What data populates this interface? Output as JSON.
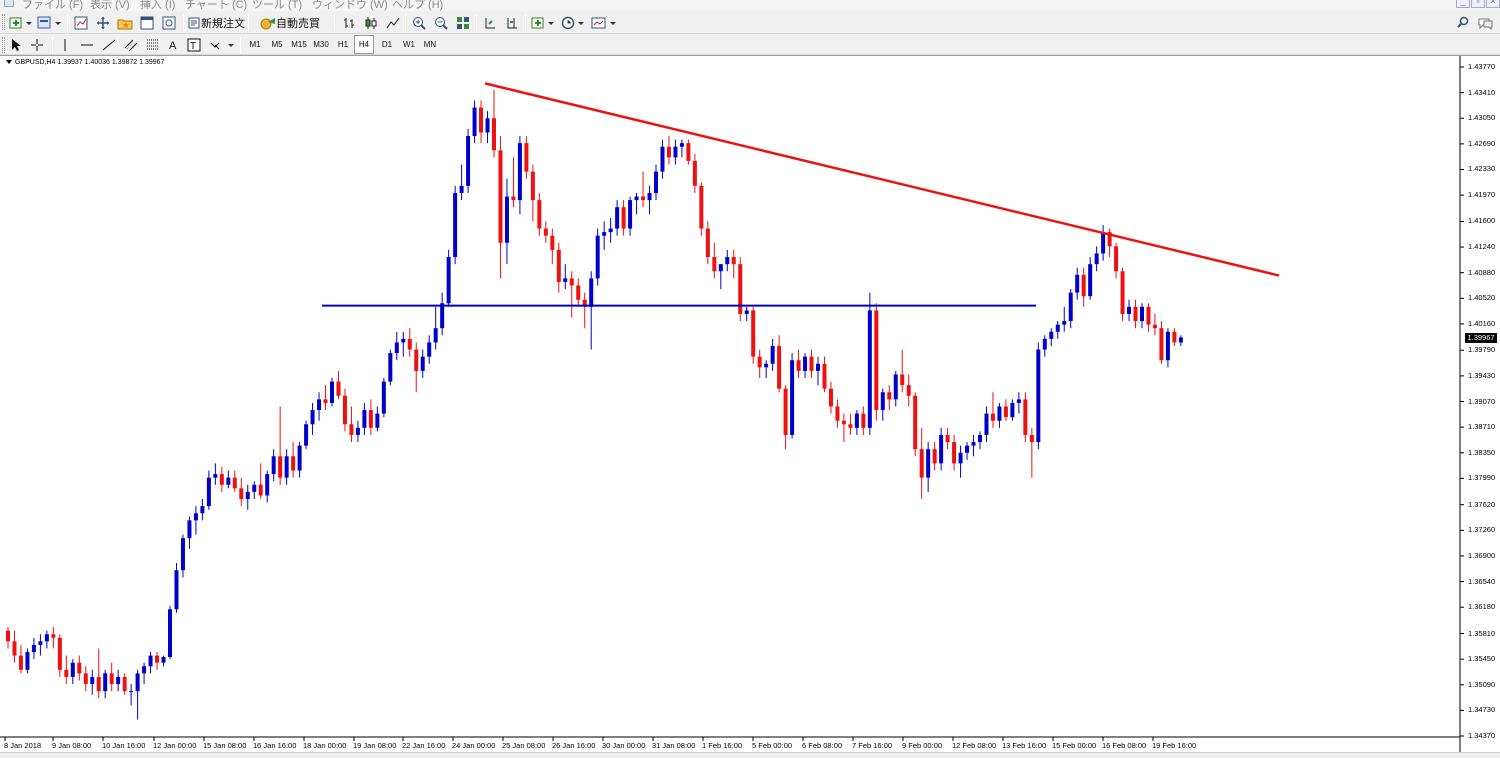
{
  "menu": {
    "items": [
      "ファイル (F)",
      "表示 (V)",
      "挿入 (I)",
      "チャート (C)",
      "ツール (T)",
      "ウィンドウ (W)",
      "ヘルプ (H)"
    ]
  },
  "toolbar": {
    "new_order_label": "新規注文",
    "auto_trade_label": "自動売買",
    "timeframes": [
      "M1",
      "M5",
      "M15",
      "M30",
      "H1",
      "H4",
      "D1",
      "W1",
      "MN"
    ],
    "active_timeframe": "H4"
  },
  "chart": {
    "header": "GBPUSD,H4  1.39937 1.40036 1.39872 1.39967",
    "current_price": "1.39967",
    "price_ticks": [
      "1.43770",
      "1.43410",
      "1.43050",
      "1.42690",
      "1.42330",
      "1.41970",
      "1.41600",
      "1.41240",
      "1.40880",
      "1.40520",
      "1.40160",
      "1.39790",
      "1.39430",
      "1.39070",
      "1.38710",
      "1.38350",
      "1.37990",
      "1.37620",
      "1.37260",
      "1.36900",
      "1.36540",
      "1.36180",
      "1.35810",
      "1.35450",
      "1.35090",
      "1.34730",
      "1.34370"
    ],
    "time_ticks": [
      "8 Jan 2018",
      "9 Jan 08:00",
      "10 Jan 16:00",
      "12 Jan 00:00",
      "15 Jan 08:00",
      "16 Jan 16:00",
      "18 Jan 00:00",
      "19 Jan 08:00",
      "22 Jan 16:00",
      "24 Jan 00:00",
      "25 Jan 08:00",
      "26 Jan 16:00",
      "30 Jan 00:00",
      "31 Jan 08:00",
      "1 Feb 16:00",
      "5 Feb 00:00",
      "6 Feb 08:00",
      "7 Feb 16:00",
      "9 Feb 00:00",
      "12 Feb 08:00",
      "13 Feb 16:00",
      "15 Feb 00:00",
      "16 Feb 08:00",
      "19 Feb 16:00"
    ],
    "colors": {
      "bull": "#0000cc",
      "bear": "#ee1111",
      "trendline": "#ee1111",
      "support": "#0000cc"
    }
  },
  "chart_data": {
    "type": "candlestick",
    "symbol": "GBPUSD",
    "timeframe": "H4",
    "ylim": [
      1.3437,
      1.4377
    ],
    "candles": [
      [
        1.3585,
        1.359,
        1.356,
        1.357
      ],
      [
        1.357,
        1.3585,
        1.354,
        1.355
      ],
      [
        1.355,
        1.3565,
        1.3525,
        1.353
      ],
      [
        1.353,
        1.356,
        1.3525,
        1.3555
      ],
      [
        1.3555,
        1.3575,
        1.3545,
        1.3565
      ],
      [
        1.3565,
        1.358,
        1.355,
        1.357
      ],
      [
        1.357,
        1.3585,
        1.356,
        1.358
      ],
      [
        1.358,
        1.359,
        1.356,
        1.3575
      ],
      [
        1.3575,
        1.358,
        1.352,
        1.353
      ],
      [
        1.353,
        1.355,
        1.351,
        1.352
      ],
      [
        1.352,
        1.3545,
        1.351,
        1.354
      ],
      [
        1.354,
        1.355,
        1.3515,
        1.3525
      ],
      [
        1.3525,
        1.3535,
        1.35,
        1.351
      ],
      [
        1.351,
        1.353,
        1.3495,
        1.352
      ],
      [
        1.352,
        1.356,
        1.349,
        1.35
      ],
      [
        1.35,
        1.353,
        1.349,
        1.3525
      ],
      [
        1.3525,
        1.354,
        1.35,
        1.351
      ],
      [
        1.351,
        1.353,
        1.35,
        1.352
      ],
      [
        1.352,
        1.3525,
        1.3495,
        1.35
      ],
      [
        1.35,
        1.351,
        1.348,
        1.35
      ],
      [
        1.35,
        1.353,
        1.346,
        1.3525
      ],
      [
        1.3525,
        1.354,
        1.351,
        1.3535
      ],
      [
        1.3535,
        1.3555,
        1.3525,
        1.355
      ],
      [
        1.355,
        1.3555,
        1.353,
        1.354
      ],
      [
        1.354,
        1.355,
        1.3535,
        1.3548
      ],
      [
        1.3548,
        1.362,
        1.3545,
        1.3615
      ],
      [
        1.3615,
        1.368,
        1.361,
        1.367
      ],
      [
        1.367,
        1.372,
        1.366,
        1.3715
      ],
      [
        1.3715,
        1.3745,
        1.37,
        1.374
      ],
      [
        1.374,
        1.376,
        1.372,
        1.375
      ],
      [
        1.375,
        1.377,
        1.374,
        1.376
      ],
      [
        1.376,
        1.381,
        1.3755,
        1.38
      ],
      [
        1.38,
        1.382,
        1.379,
        1.3805
      ],
      [
        1.3805,
        1.3815,
        1.378,
        1.379
      ],
      [
        1.379,
        1.381,
        1.3785,
        1.38
      ],
      [
        1.38,
        1.381,
        1.378,
        1.3785
      ],
      [
        1.3785,
        1.38,
        1.376,
        1.377
      ],
      [
        1.377,
        1.379,
        1.3755,
        1.378
      ],
      [
        1.378,
        1.3795,
        1.377,
        1.379
      ],
      [
        1.379,
        1.382,
        1.377,
        1.3775
      ],
      [
        1.3775,
        1.381,
        1.3765,
        1.3805
      ],
      [
        1.3805,
        1.384,
        1.3795,
        1.383
      ],
      [
        1.383,
        1.39,
        1.379,
        1.38
      ],
      [
        1.38,
        1.384,
        1.379,
        1.383
      ],
      [
        1.383,
        1.385,
        1.38,
        1.381
      ],
      [
        1.381,
        1.385,
        1.38,
        1.3845
      ],
      [
        1.3845,
        1.388,
        1.384,
        1.3875
      ],
      [
        1.3875,
        1.3905,
        1.386,
        1.3895
      ],
      [
        1.3895,
        1.392,
        1.388,
        1.391
      ],
      [
        1.391,
        1.393,
        1.3895,
        1.3905
      ],
      [
        1.3905,
        1.394,
        1.39,
        1.3935
      ],
      [
        1.3935,
        1.395,
        1.391,
        1.3915
      ],
      [
        1.3915,
        1.3925,
        1.3865,
        1.3875
      ],
      [
        1.3875,
        1.39,
        1.385,
        1.386
      ],
      [
        1.386,
        1.388,
        1.385,
        1.387
      ],
      [
        1.387,
        1.3905,
        1.386,
        1.3895
      ],
      [
        1.3895,
        1.391,
        1.386,
        1.387
      ],
      [
        1.387,
        1.39,
        1.3865,
        1.389
      ],
      [
        1.389,
        1.394,
        1.3885,
        1.3935
      ],
      [
        1.3935,
        1.398,
        1.393,
        1.3975
      ],
      [
        1.3975,
        1.4005,
        1.3965,
        1.399
      ],
      [
        1.399,
        1.4005,
        1.397,
        1.3995
      ],
      [
        1.3995,
        1.401,
        1.397,
        1.398
      ],
      [
        1.398,
        1.399,
        1.392,
        1.395
      ],
      [
        1.395,
        1.398,
        1.394,
        1.397
      ],
      [
        1.397,
        1.4,
        1.396,
        1.399
      ],
      [
        1.399,
        1.404,
        1.398,
        1.401
      ],
      [
        1.401,
        1.406,
        1.4,
        1.4045
      ],
      [
        1.4045,
        1.412,
        1.404,
        1.411
      ],
      [
        1.411,
        1.421,
        1.41,
        1.42
      ],
      [
        1.42,
        1.424,
        1.419,
        1.421
      ],
      [
        1.421,
        1.429,
        1.42,
        1.428
      ],
      [
        1.428,
        1.433,
        1.427,
        1.432
      ],
      [
        1.432,
        1.433,
        1.427,
        1.4285
      ],
      [
        1.4285,
        1.4315,
        1.427,
        1.4305
      ],
      [
        1.4305,
        1.4345,
        1.425,
        1.426
      ],
      [
        1.426,
        1.428,
        1.408,
        1.413
      ],
      [
        1.413,
        1.422,
        1.41,
        1.4195
      ],
      [
        1.4195,
        1.425,
        1.418,
        1.419
      ],
      [
        1.419,
        1.428,
        1.417,
        1.427
      ],
      [
        1.427,
        1.428,
        1.422,
        1.423
      ],
      [
        1.423,
        1.424,
        1.416,
        1.419
      ],
      [
        1.419,
        1.42,
        1.414,
        1.415
      ],
      [
        1.415,
        1.416,
        1.413,
        1.414
      ],
      [
        1.414,
        1.415,
        1.41,
        1.412
      ],
      [
        1.412,
        1.413,
        1.406,
        1.4075
      ],
      [
        1.4075,
        1.41,
        1.4065,
        1.408
      ],
      [
        1.408,
        1.409,
        1.4025,
        1.407
      ],
      [
        1.407,
        1.408,
        1.404,
        1.405
      ],
      [
        1.405,
        1.406,
        1.401,
        1.404
      ],
      [
        1.404,
        1.409,
        1.398,
        1.408
      ],
      [
        1.408,
        1.415,
        1.407,
        1.414
      ],
      [
        1.414,
        1.416,
        1.412,
        1.4145
      ],
      [
        1.4145,
        1.4165,
        1.413,
        1.415
      ],
      [
        1.415,
        1.419,
        1.414,
        1.418
      ],
      [
        1.418,
        1.419,
        1.414,
        1.415
      ],
      [
        1.415,
        1.4195,
        1.414,
        1.419
      ],
      [
        1.419,
        1.42,
        1.417,
        1.4195
      ],
      [
        1.4195,
        1.423,
        1.418,
        1.419
      ],
      [
        1.419,
        1.421,
        1.417,
        1.42
      ],
      [
        1.42,
        1.424,
        1.419,
        1.423
      ],
      [
        1.423,
        1.4275,
        1.422,
        1.4265
      ],
      [
        1.4265,
        1.428,
        1.424,
        1.425
      ],
      [
        1.425,
        1.4275,
        1.424,
        1.4265
      ],
      [
        1.4265,
        1.4275,
        1.425,
        1.427
      ],
      [
        1.427,
        1.4275,
        1.424,
        1.4245
      ],
      [
        1.4245,
        1.4255,
        1.42,
        1.421
      ],
      [
        1.421,
        1.4215,
        1.414,
        1.415
      ],
      [
        1.415,
        1.416,
        1.41,
        1.411
      ],
      [
        1.411,
        1.413,
        1.408,
        1.409
      ],
      [
        1.409,
        1.41,
        1.4065,
        1.41
      ],
      [
        1.41,
        1.412,
        1.409,
        1.411
      ],
      [
        1.411,
        1.412,
        1.408,
        1.41
      ],
      [
        1.41,
        1.411,
        1.402,
        1.403
      ],
      [
        1.403,
        1.404,
        1.402,
        1.4035
      ],
      [
        1.4035,
        1.404,
        1.396,
        1.397
      ],
      [
        1.397,
        1.398,
        1.394,
        1.3955
      ],
      [
        1.3955,
        1.3965,
        1.394,
        1.396
      ],
      [
        1.396,
        1.3995,
        1.395,
        1.3985
      ],
      [
        1.3985,
        1.4,
        1.392,
        1.3925
      ],
      [
        1.3925,
        1.393,
        1.384,
        1.386
      ],
      [
        1.386,
        1.3975,
        1.3855,
        1.3965
      ],
      [
        1.3965,
        1.398,
        1.394,
        1.395
      ],
      [
        1.395,
        1.3975,
        1.394,
        1.397
      ],
      [
        1.397,
        1.398,
        1.394,
        1.395
      ],
      [
        1.395,
        1.397,
        1.393,
        1.396
      ],
      [
        1.396,
        1.397,
        1.392,
        1.3925
      ],
      [
        1.3925,
        1.3935,
        1.389,
        1.39
      ],
      [
        1.39,
        1.391,
        1.387,
        1.388
      ],
      [
        1.388,
        1.389,
        1.385,
        1.3875
      ],
      [
        1.3875,
        1.389,
        1.386,
        1.387
      ],
      [
        1.387,
        1.3895,
        1.386,
        1.389
      ],
      [
        1.389,
        1.39,
        1.386,
        1.387
      ],
      [
        1.387,
        1.406,
        1.386,
        1.4035
      ],
      [
        1.4035,
        1.4045,
        1.388,
        1.3895
      ],
      [
        1.3895,
        1.3925,
        1.388,
        1.392
      ],
      [
        1.392,
        1.393,
        1.3895,
        1.391
      ],
      [
        1.391,
        1.395,
        1.39,
        1.3945
      ],
      [
        1.3945,
        1.398,
        1.392,
        1.393
      ],
      [
        1.393,
        1.3945,
        1.39,
        1.3915
      ],
      [
        1.3915,
        1.392,
        1.383,
        1.384
      ],
      [
        1.384,
        1.387,
        1.377,
        1.38
      ],
      [
        1.38,
        1.385,
        1.378,
        1.384
      ],
      [
        1.384,
        1.385,
        1.381,
        1.382
      ],
      [
        1.382,
        1.387,
        1.381,
        1.386
      ],
      [
        1.386,
        1.387,
        1.384,
        1.385
      ],
      [
        1.385,
        1.386,
        1.381,
        1.382
      ],
      [
        1.382,
        1.3845,
        1.38,
        1.3835
      ],
      [
        1.3835,
        1.385,
        1.3825,
        1.3845
      ],
      [
        1.3845,
        1.386,
        1.383,
        1.385
      ],
      [
        1.385,
        1.3865,
        1.384,
        1.386
      ],
      [
        1.386,
        1.39,
        1.385,
        1.389
      ],
      [
        1.389,
        1.392,
        1.387,
        1.388
      ],
      [
        1.388,
        1.3905,
        1.387,
        1.39
      ],
      [
        1.39,
        1.391,
        1.388,
        1.3885
      ],
      [
        1.3885,
        1.391,
        1.388,
        1.3905
      ],
      [
        1.3905,
        1.392,
        1.389,
        1.391
      ],
      [
        1.391,
        1.392,
        1.385,
        1.386
      ],
      [
        1.386,
        1.387,
        1.38,
        1.385
      ],
      [
        1.385,
        1.399,
        1.384,
        1.398
      ],
      [
        1.398,
        1.4,
        1.397,
        1.3995
      ],
      [
        1.3995,
        1.401,
        1.3985,
        1.4005
      ],
      [
        1.4005,
        1.402,
        1.3995,
        1.4015
      ],
      [
        1.4015,
        1.404,
        1.4005,
        1.402
      ],
      [
        1.402,
        1.4065,
        1.401,
        1.406
      ],
      [
        1.406,
        1.4095,
        1.405,
        1.4085
      ],
      [
        1.4085,
        1.4095,
        1.404,
        1.4055
      ],
      [
        1.4055,
        1.411,
        1.405,
        1.41
      ],
      [
        1.41,
        1.4125,
        1.409,
        1.4115
      ],
      [
        1.4115,
        1.4155,
        1.4105,
        1.4145
      ],
      [
        1.4145,
        1.415,
        1.411,
        1.4125
      ],
      [
        1.4125,
        1.413,
        1.408,
        1.409
      ],
      [
        1.409,
        1.4095,
        1.402,
        1.403
      ],
      [
        1.403,
        1.405,
        1.402,
        1.404
      ],
      [
        1.404,
        1.405,
        1.401,
        1.402
      ],
      [
        1.402,
        1.4045,
        1.401,
        1.404
      ],
      [
        1.404,
        1.4045,
        1.4005,
        1.4015
      ],
      [
        1.4015,
        1.403,
        1.4,
        1.401
      ],
      [
        1.401,
        1.402,
        1.396,
        1.3965
      ],
      [
        1.3965,
        1.401,
        1.3955,
        1.4005
      ],
      [
        1.4005,
        1.401,
        1.3985,
        1.399
      ],
      [
        1.399,
        1.4,
        1.3985,
        1.3997
      ]
    ],
    "horizontal_line": 1.40418,
    "trendline": {
      "from_price": 1.4354,
      "to_price": 1.4084
    }
  }
}
